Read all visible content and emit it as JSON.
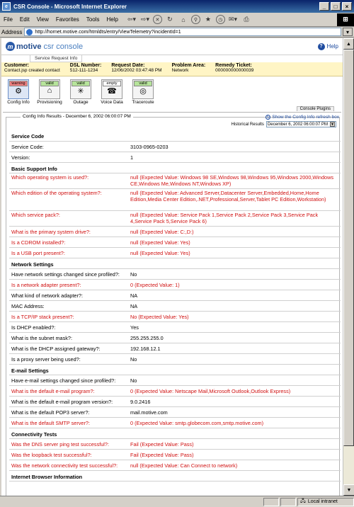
{
  "window": {
    "title": "CSR Console - Microsoft Internet Explorer",
    "menus": [
      "File",
      "Edit",
      "View",
      "Favorites",
      "Tools",
      "Help"
    ],
    "address_label": "Address",
    "url": "http://hornet.motive.com/htmldts/entry/ViewTelemetry?incidentId=1",
    "status_zone": "Local intranet"
  },
  "header": {
    "logo_brand": "motive",
    "logo_product": "csr console",
    "help_label": "Help",
    "tab_label": "Service Request Info"
  },
  "info": {
    "customer_h": "Customer:",
    "customer_v": "Contact.jsp created contact",
    "dsl_h": "DSL Number:",
    "dsl_v": "512-111-1234",
    "req_h": "Request Date:",
    "req_v": "12/06/2002 03:47:48 PM",
    "prob_h": "Problem Area:",
    "prob_v": "Network",
    "ticket_h": "Remedy Ticket:",
    "ticket_v": "000000000000039"
  },
  "plugins": [
    {
      "badge": "warning",
      "label": "Config Info",
      "icon": "⚙"
    },
    {
      "badge": "valid",
      "label": "Provisioning",
      "icon": "⌂"
    },
    {
      "badge": "valid",
      "label": "Outage",
      "icon": "✳"
    },
    {
      "badge": "empty",
      "label": "Voice Data",
      "icon": "☎"
    },
    {
      "badge": "valid",
      "label": "Traceroute",
      "icon": "◎"
    }
  ],
  "plugins_tab": "Console Plugins",
  "results": {
    "tab": "Config Info Results - December 6, 2002 06:00:07 PM",
    "refresh": "Show the Config Info refresh box",
    "hist_label": "Historical Results",
    "hist_value": "December 6, 2002 06:00:07 PM"
  },
  "rows": [
    {
      "k": "sec",
      "q": "Service Code"
    },
    {
      "k": "r",
      "q": "Service Code:",
      "a": "3103-0965-0203"
    },
    {
      "k": "r",
      "q": "Version:",
      "a": "1"
    },
    {
      "k": "sec",
      "q": "Basic Support Info"
    },
    {
      "k": "r2",
      "red": true,
      "q": "Which operating system is used?:",
      "a": "null (Expected Value: Windows 98 SE,Windows 98,Windows 95,Windows 2000,Windows CE,Windows Me,Windows NT,Windows XP)"
    },
    {
      "k": "r3",
      "red": true,
      "q": "Which edition of the operating system?:",
      "a": "null (Expected Value: Advanced Server,Datacenter Server,Embedded,Home,Home Edition,Media Center Edition,.NET,Professional,Server,Tablet PC Edition,Workstation)"
    },
    {
      "k": "r2",
      "red": true,
      "q": "Which service pack?:",
      "a": "null (Expected Value: Service Pack 1,Service Pack 2,Service Pack 3,Service Pack 4,Service Pack 5,Service Pack 6)"
    },
    {
      "k": "r",
      "red": true,
      "q": "What is the primary system drive?:",
      "a": "null (Expected Value: C:,D:)"
    },
    {
      "k": "r",
      "red": true,
      "q": "Is a CDROM installed?:",
      "a": "null (Expected Value: Yes)"
    },
    {
      "k": "r",
      "red": true,
      "q": "Is a USB port present?:",
      "a": "null (Expected Value: Yes)"
    },
    {
      "k": "sec",
      "q": "Network Settings"
    },
    {
      "k": "r",
      "q": "Have network settings changed since profiled?:",
      "a": "No"
    },
    {
      "k": "r",
      "red": true,
      "q": "Is a network adapter present?:",
      "a": "0 (Expected Value: 1)"
    },
    {
      "k": "r",
      "q": "What kind of network adapter?:",
      "a": "NA"
    },
    {
      "k": "r",
      "q": "MAC Address:",
      "a": "NA"
    },
    {
      "k": "r",
      "red": true,
      "q": "Is a TCP/IP stack present?:",
      "a": "No (Expected Value: Yes)"
    },
    {
      "k": "r",
      "q": "Is DHCP enabled?:",
      "a": "Yes"
    },
    {
      "k": "r",
      "q": "What is the subnet mask?:",
      "a": "255.255.255.0"
    },
    {
      "k": "r",
      "q": "What is the DHCP assigned gateway?:",
      "a": "192.168.12.1"
    },
    {
      "k": "r",
      "q": "Is a proxy server being used?:",
      "a": "No"
    },
    {
      "k": "sec",
      "q": "E-mail Settings"
    },
    {
      "k": "r",
      "q": "Have e-mail settings changed since profiled?:",
      "a": "No"
    },
    {
      "k": "r",
      "red": true,
      "q": "What is the default e-mail program?:",
      "a": "0 (Expected Value: Netscape Mail,Microsoft Outlook,Outlook Express)"
    },
    {
      "k": "r",
      "q": "What is the default e-mail program version?:",
      "a": "9.0.2416"
    },
    {
      "k": "r",
      "q": "What is the default POP3 server?:",
      "a": "mail.motive.com"
    },
    {
      "k": "r",
      "red": true,
      "q": "What is the default SMTP server?:",
      "a": "0 (Expected Value: smtp.globecom.com,smtp.motive.com)"
    },
    {
      "k": "sec",
      "q": "Connectivity Tests"
    },
    {
      "k": "r",
      "red": true,
      "q": "Was the DNS server ping test successful?:",
      "a": "Fail (Expected Value: Pass)"
    },
    {
      "k": "r",
      "red": true,
      "q": "Was the loopback test successful?:",
      "a": "Fail (Expected Value: Pass)"
    },
    {
      "k": "r",
      "red": true,
      "q": "Was the network connectivity test successful?:",
      "a": "null (Expected Value: Can Connect to network)"
    },
    {
      "k": "sec",
      "q": "Internet Browser Information"
    }
  ]
}
